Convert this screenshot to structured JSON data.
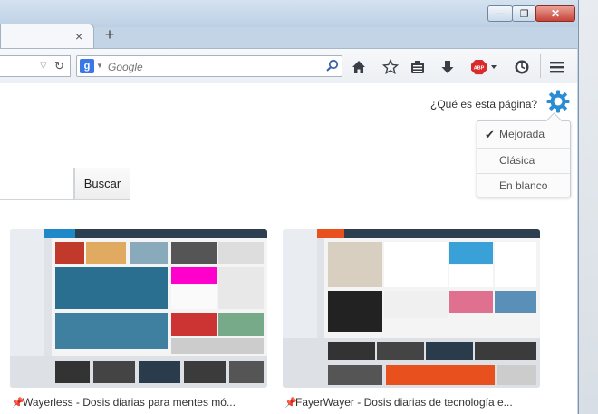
{
  "window": {
    "min_glyph": "—",
    "max_glyph": "❐",
    "close_glyph": "✕"
  },
  "tab": {
    "close_glyph": "×",
    "new_tab_glyph": "+"
  },
  "toolbar": {
    "search_placeholder": "Google",
    "search_engine_badge": "g"
  },
  "page": {
    "what_is_link": "¿Qué es esta página?",
    "menu": [
      {
        "label": "Mejorada",
        "checked": true
      },
      {
        "label": "Clásica",
        "checked": false
      },
      {
        "label": "En blanco",
        "checked": false
      }
    ],
    "search_button": "Buscar",
    "tiles": [
      {
        "caption": "Wayerless - Dosis diarias para mentes mó...",
        "brand_color": "#1e88c8"
      },
      {
        "caption": "FayerWayer - Dosis diarias de tecnología e...",
        "brand_color": "#e8501e"
      }
    ]
  },
  "colors": {
    "accent": "#2a8dd4",
    "gear": "#2a8dd4",
    "adblock": "#d92b2b"
  }
}
